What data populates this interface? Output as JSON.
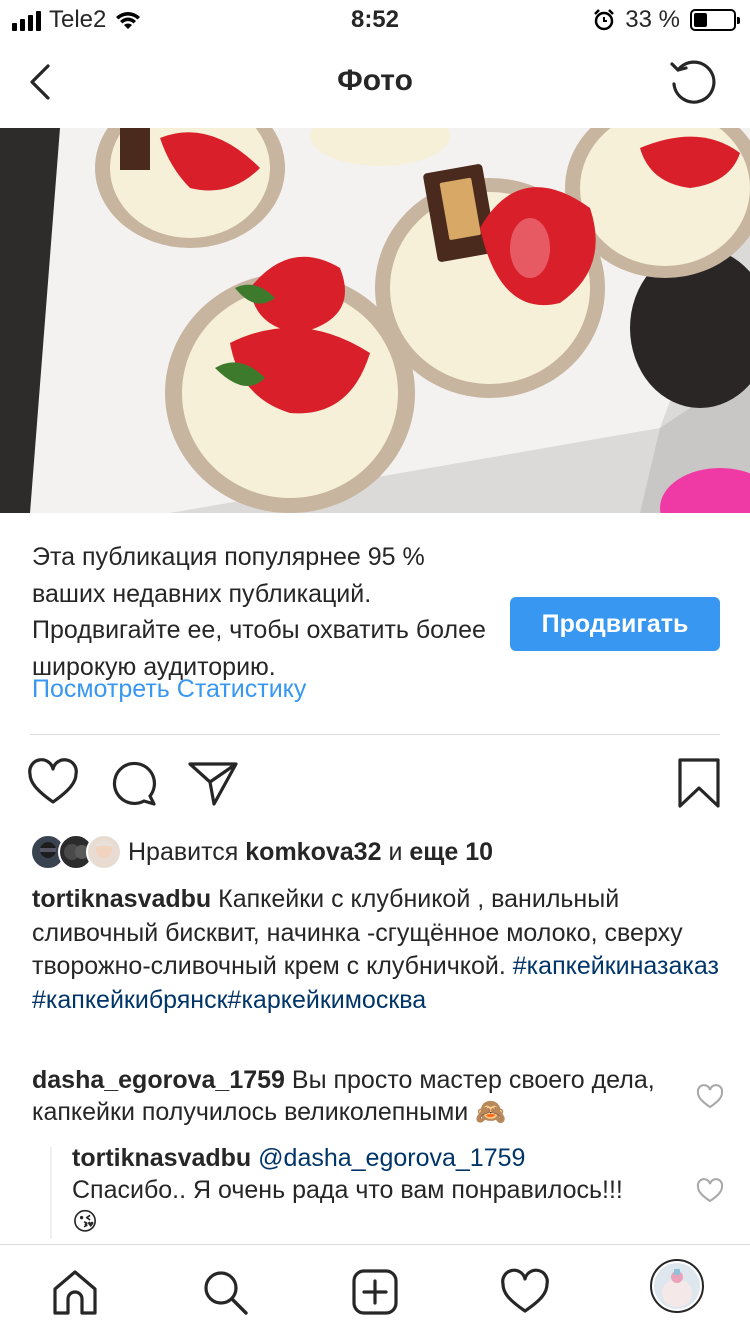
{
  "status_bar": {
    "carrier": "Tele2",
    "time": "8:52",
    "battery_percent": "33 %",
    "battery_level": 0.33
  },
  "header": {
    "title": "Фото",
    "back_icon": "chevron-left-icon",
    "refresh_icon": "refresh-icon"
  },
  "photo": {
    "icon": "cupcakes-photo"
  },
  "promo": {
    "text": "Эта публикация популярнее 95 % ваших недавних публикаций. Продвигайте ее, чтобы охватить более широкую аудиторию.",
    "stats_link": "Посмотреть Статистику",
    "button_label": "Продвигать",
    "button_color": "#3897f0"
  },
  "actions": {
    "like_icon": "heart-icon",
    "comment_icon": "comment-icon",
    "share_icon": "paper-plane-icon",
    "save_icon": "bookmark-icon"
  },
  "likes": {
    "prefix": "Нравится",
    "user": "komkova32",
    "connector": "и",
    "more": "еще 10"
  },
  "caption": {
    "username": "tortiknasvadbu",
    "text": "Капкейки с клубникой , ванильный сливочный бисквит, начинка -сгущённое молоко, сверху творожно-сливочный крем с клубничкой.",
    "hashtags": "#капкейкиназаказ#капкейкибрянск#каркейкимосква"
  },
  "comments": [
    {
      "username": "dasha_egorova_1759",
      "text": "Вы просто мастер своего дела, капкейки получилось великолепными 🙈"
    },
    {
      "username": "tortiknasvadbu",
      "mention": "@dasha_egorova_1759",
      "text": "Спасибо.. Я очень рада что вам понравилось!!! 😘"
    }
  ],
  "tab_bar": {
    "items": [
      "home-icon",
      "search-icon",
      "add-post-icon",
      "activity-heart-icon",
      "profile-avatar"
    ]
  },
  "colors": {
    "link": "#3897f0",
    "hashtag": "#003569",
    "text": "#262626",
    "divider": "#dbdbdb"
  }
}
